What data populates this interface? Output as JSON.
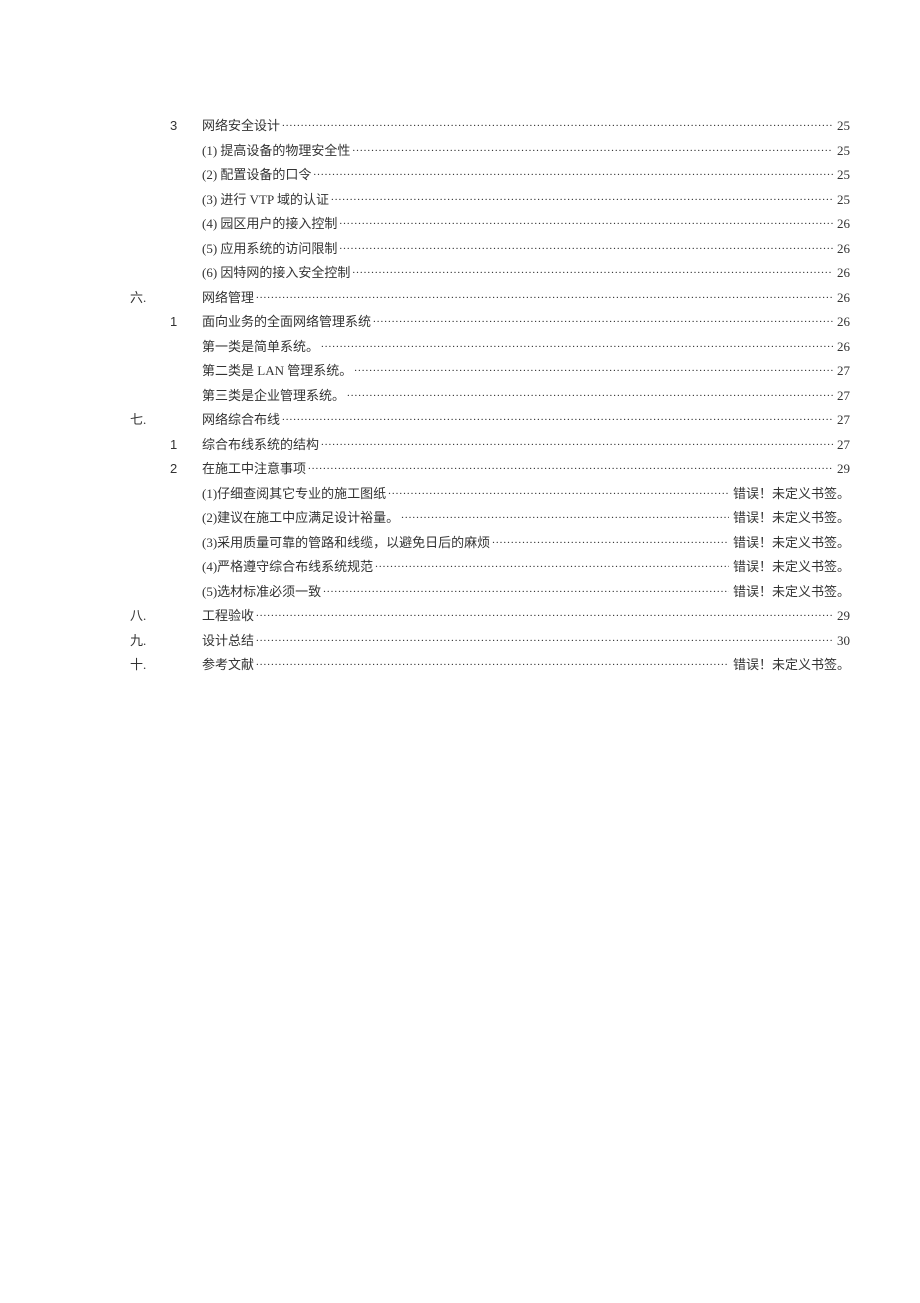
{
  "toc": [
    {
      "colA": "",
      "colB": "3",
      "title": "网络安全设计",
      "page": "25"
    },
    {
      "colA": "",
      "colB": "",
      "title": "(1) 提高设备的物理安全性",
      "page": "25"
    },
    {
      "colA": "",
      "colB": "",
      "title": "(2) 配置设备的口令",
      "page": "25"
    },
    {
      "colA": "",
      "colB": "",
      "title": "(3) 进行 VTP 域的认证",
      "page": "25"
    },
    {
      "colA": "",
      "colB": "",
      "title": "(4) 园区用户的接入控制",
      "page": "26"
    },
    {
      "colA": "",
      "colB": "",
      "title": "(5) 应用系统的访问限制",
      "page": "26"
    },
    {
      "colA": "",
      "colB": "",
      "title": "(6) 因特网的接入安全控制",
      "page": "26"
    },
    {
      "colA": "六.",
      "colB": "",
      "title": "网络管理",
      "page": "26"
    },
    {
      "colA": "",
      "colB": "1",
      "title": "面向业务的全面网络管理系统",
      "page": "26"
    },
    {
      "colA": "",
      "colB": "",
      "title": "第一类是简单系统。",
      "page": "26"
    },
    {
      "colA": "",
      "colB": "",
      "title": "第二类是  LAN 管理系统。",
      "page": "27"
    },
    {
      "colA": "",
      "colB": "",
      "title": "第三类是企业管理系统。",
      "page": "27"
    },
    {
      "colA": "七.",
      "colB": "",
      "title": "网络综合布线",
      "page": "27"
    },
    {
      "colA": "",
      "colB": "1",
      "title": "综合布线系统的结构",
      "page": "27"
    },
    {
      "colA": "",
      "colB": "2",
      "title": "在施工中注意事项",
      "page": "29"
    },
    {
      "colA": "",
      "colB": "",
      "title": "(1)仔细查阅其它专业的施工图纸",
      "page": "错误！未定义书签。"
    },
    {
      "colA": "",
      "colB": "",
      "title": "(2)建议在施工中应满足设计裕量。",
      "page": "错误！未定义书签。"
    },
    {
      "colA": "",
      "colB": "",
      "title": "(3)采用质量可靠的管路和线缆，以避免日后的麻烦",
      "page": "错误！未定义书签。"
    },
    {
      "colA": "",
      "colB": "",
      "title": "(4)严格遵守综合布线系统规范",
      "page": "错误！未定义书签。"
    },
    {
      "colA": "",
      "colB": "",
      "title": "(5)选材标准必须一致",
      "page": "错误！未定义书签。"
    },
    {
      "colA": "八.",
      "colB": "",
      "title": "工程验收",
      "page": "29"
    },
    {
      "colA": "九.",
      "colB": "",
      "title": "设计总结",
      "page": "30"
    },
    {
      "colA": "十.",
      "colB": "",
      "title": "参考文献",
      "page": "错误！未定义书签。"
    }
  ]
}
